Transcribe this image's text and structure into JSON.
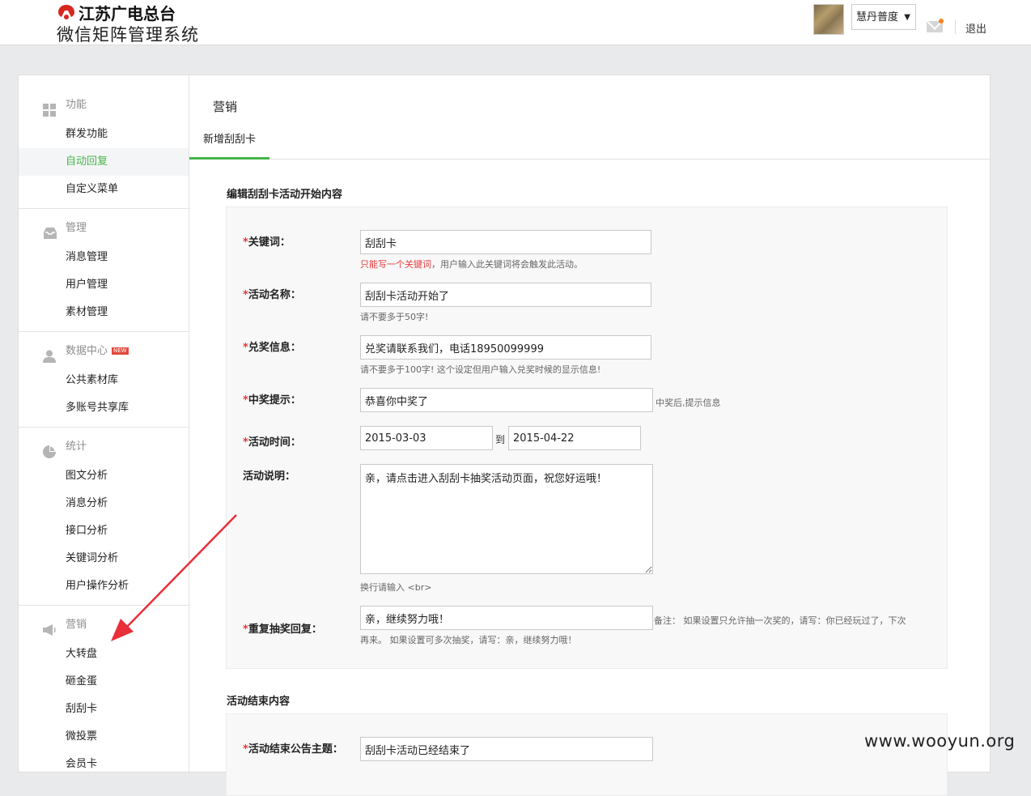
{
  "header": {
    "brand_line1": "江苏广电总台",
    "brand_line2": "微信矩阵管理系统",
    "account_name": "慧丹普度",
    "logout_label": "退出"
  },
  "sidebar": {
    "groups": [
      {
        "title": "功能",
        "icon": "grid-icon",
        "items": [
          "群发功能",
          "自动回复",
          "自定义菜单"
        ],
        "active_index": 1
      },
      {
        "title": "管理",
        "icon": "inbox-icon",
        "items": [
          "消息管理",
          "用户管理",
          "素材管理"
        ]
      },
      {
        "title": "数据中心",
        "icon": "user-icon",
        "badge": "NEW",
        "items": [
          "公共素材库",
          "多账号共享库"
        ]
      },
      {
        "title": "统计",
        "icon": "pie-chart-icon",
        "items": [
          "图文分析",
          "消息分析",
          "接口分析",
          "关键词分析",
          "用户操作分析"
        ]
      },
      {
        "title": "营销",
        "icon": "megaphone-icon",
        "items": [
          "大转盘",
          "砸金蛋",
          "刮刮卡",
          "微投票",
          "会员卡"
        ]
      }
    ]
  },
  "main": {
    "title": "营销",
    "tab": "新增刮刮卡",
    "section1_title": "编辑刮刮卡活动开始内容",
    "section2_title": "活动结束内容",
    "form": {
      "keyword": {
        "label": "关键词：",
        "value": "刮刮卡",
        "hint_warn": "只能写一个关键词",
        "hint": "，用户输入此关键词将会触发此活动。"
      },
      "activity_name": {
        "label": "活动名称：",
        "value": "刮刮卡活动开始了",
        "hint": "请不要多于50字!"
      },
      "prize_info": {
        "label": "兑奖信息：",
        "value": "兑奖请联系我们，电话18950099999",
        "hint": "请不要多于100字! 这个设定但用户输入兑奖时候的显示信息!"
      },
      "win_tip": {
        "label": "中奖提示：",
        "value": "恭喜你中奖了",
        "hint": "中奖后,提示信息"
      },
      "activity_time": {
        "label": "活动时间：",
        "start": "2015-03-03",
        "sep": "到",
        "end": "2015-04-22"
      },
      "description": {
        "label": "活动说明：",
        "value": "亲，请点击进入刮刮卡抽奖活动页面，祝您好运哦！",
        "hint": "换行请输入 <br>"
      },
      "repeat_reply": {
        "label": "重复抽奖回复：",
        "value": "亲，继续努力哦！",
        "hint_line1": "备注： 如果设置只允许抽一次奖的，请写：你已经玩过了，下次",
        "hint_line2": "再来。 如果设置可多次抽奖，请写：亲，继续努力哦！"
      },
      "end_title": {
        "label": "活动结束公告主题：",
        "value": "刮刮卡活动已经结束了"
      }
    }
  },
  "watermark": "www.wooyun.org",
  "colors": {
    "accent": "#44b549",
    "required": "#e4393c",
    "arrow": "#e8303a"
  }
}
